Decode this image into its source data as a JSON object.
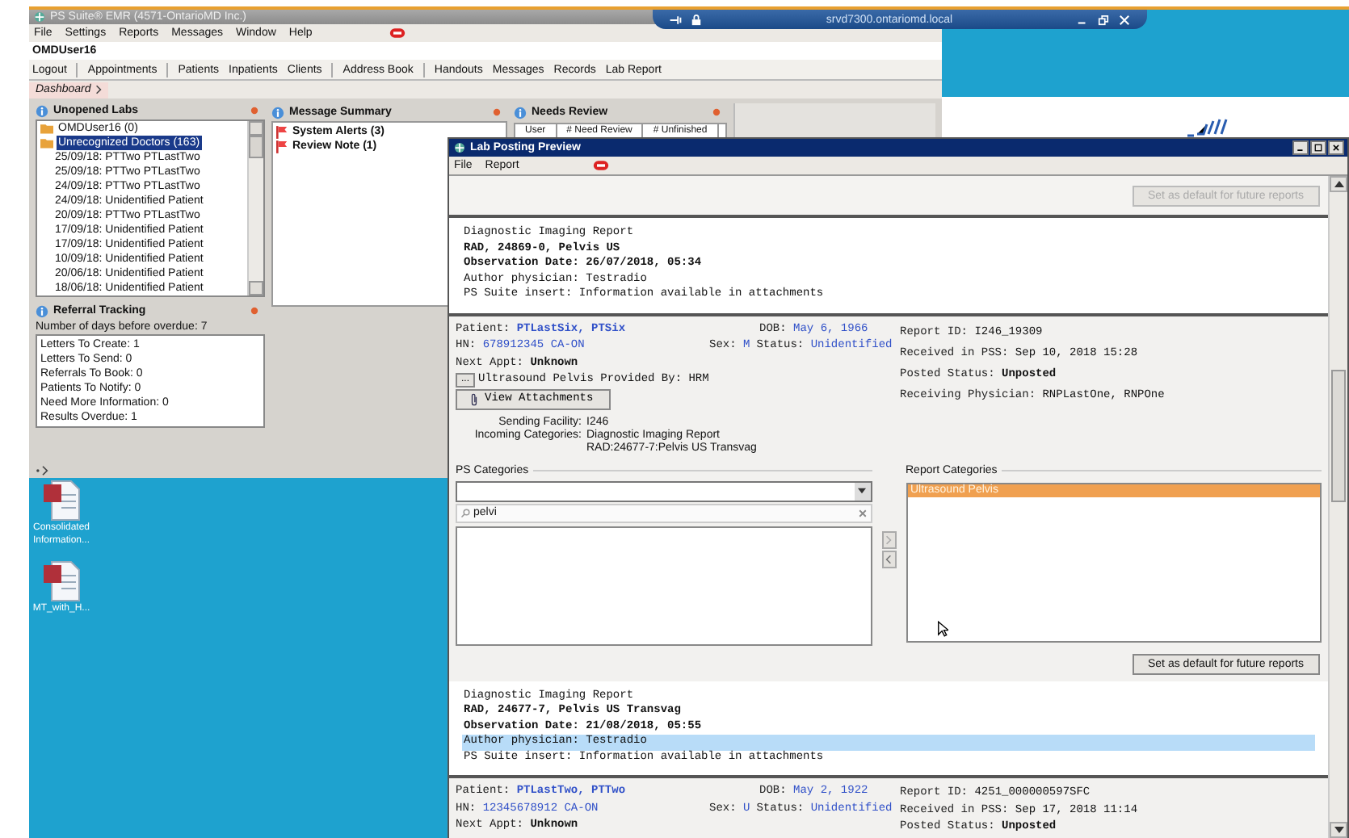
{
  "remote_bar": {
    "host": "srvd7300.ontariomd.local"
  },
  "emr": {
    "title": "PS Suite® EMR  (4571-OntarioMD Inc.)",
    "menu": [
      "File",
      "Settings",
      "Reports",
      "Messages",
      "Window",
      "Help"
    ],
    "user": "OMDUser16",
    "toolbar": [
      [
        "Logout"
      ],
      [
        "Appointments"
      ],
      [
        "Patients",
        "Inpatients",
        "Clients"
      ],
      [
        "Address Book"
      ],
      [
        "Handouts",
        "Messages",
        "Records",
        "Lab Report"
      ]
    ],
    "breadcrumb": "Dashboard",
    "unopened_labs": {
      "title": "Unopened Labs",
      "tree": [
        {
          "label": "OMDUser16 (0)",
          "selected": false
        },
        {
          "label": "Unrecognized Doctors (163)",
          "selected": true,
          "children": [
            {
              "label": "25/09/18: PTTwo PTLastTwo",
              "selected": false
            },
            {
              "label": "25/09/18: PTTwo PTLastTwo",
              "selected": false
            },
            {
              "label": "24/09/18: PTTwo PTLastTwo",
              "selected": false
            },
            {
              "label": "24/09/18: Unidentified Patient",
              "selected": false
            },
            {
              "label": "20/09/18: PTTwo PTLastTwo",
              "selected": false
            },
            {
              "label": "17/09/18: Unidentified Patient",
              "selected": false
            },
            {
              "label": "17/09/18: Unidentified Patient",
              "selected": false
            },
            {
              "label": "10/09/18: Unidentified Patient",
              "selected": false
            },
            {
              "label": "20/06/18: Unidentified Patient",
              "selected": false
            },
            {
              "label": "18/06/18: Unidentified Patient",
              "selected": false
            }
          ]
        }
      ]
    },
    "message_summary": {
      "title": "Message Summary",
      "items": [
        "System Alerts (3)",
        "Review Note (1)"
      ]
    },
    "needs_review": {
      "title": "Needs Review",
      "columns": [
        "User",
        "# Need Review",
        "# Unfinished"
      ]
    },
    "referral_tracking": {
      "title": "Referral Tracking",
      "overdue_note": "Number of days before overdue: 7",
      "items": [
        "Letters To Create: 1",
        "Letters To Send: 0",
        "Referrals To Book: 0",
        "Patients To Notify: 0",
        "Need More Information: 0",
        "Results Overdue: 1"
      ]
    }
  },
  "desktop_icons": [
    {
      "label": "Consolidated Information..."
    },
    {
      "label": "MT_with_H..."
    }
  ],
  "lab_preview": {
    "title": "Lab Posting Preview",
    "menu": [
      "File",
      "Report"
    ],
    "sections": [
      {
        "kind": "toolbar",
        "button": {
          "label": "Set as default for future reports",
          "disabled": true
        }
      },
      {
        "kind": "report",
        "lines": [
          {
            "text": "Diagnostic Imaging Report",
            "bold": false,
            "selected": false
          },
          {
            "text": "RAD, 24869-0, Pelvis US",
            "bold": true,
            "selected": false
          },
          {
            "text": "Observation Date: 26/07/2018, 05:34",
            "bold": true,
            "selected": false
          },
          {
            "text": "Author physician: Testradio",
            "bold": false,
            "selected": false
          },
          {
            "text": "PS Suite insert: Information available in attachments",
            "bold": false,
            "selected": false
          }
        ]
      },
      {
        "kind": "patient",
        "patient": {
          "label": "Patient:",
          "value": "PTLastSix, PTSix"
        },
        "dob": {
          "label": "DOB:",
          "value": "May 6, 1966"
        },
        "hn": {
          "label": "HN:",
          "value": "678912345 CA-ON"
        },
        "sex": {
          "label": "Sex:",
          "value": "M"
        },
        "status": {
          "label": "Status:",
          "value": "Unidentified"
        },
        "next_appt": {
          "label": "Next Appt:",
          "value": "Unknown"
        },
        "more_button": "...",
        "provided_by": "Ultrasound Pelvis Provided By: HRM",
        "attachments_button": "View Attachments",
        "report_info": [
          {
            "label": "Report ID:",
            "value": "I246_19309",
            "bold": false
          },
          {
            "label": "Received in PSS:",
            "value": "Sep 10, 2018 15:28",
            "bold": false
          },
          {
            "label": "Posted Status:",
            "value": "Unposted",
            "bold": true
          },
          {
            "label": "Receiving Physician:",
            "value": "RNPLastOne, RNPOne",
            "bold": false
          }
        ],
        "facility": [
          {
            "label": "Sending Facility:",
            "lines": [
              "I246"
            ]
          },
          {
            "label": "Incoming Categories:",
            "lines": [
              "Diagnostic Imaging Report",
              "RAD:24677-7:Pelvis US Transvag"
            ]
          }
        ],
        "categories": {
          "ps_title": "PS Categories",
          "search": {
            "value": "pelvi"
          },
          "report_title": "Report Categories",
          "report_items": [
            {
              "label": "Ultrasound Pelvis",
              "selected": true
            }
          ]
        },
        "default_button": {
          "label": "Set as default for future reports",
          "disabled": false
        }
      },
      {
        "kind": "report",
        "lines": [
          {
            "text": "Diagnostic Imaging Report",
            "bold": false,
            "selected": false
          },
          {
            "text": "RAD, 24677-7, Pelvis US Transvag",
            "bold": true,
            "selected": false
          },
          {
            "text": "Observation Date: 21/08/2018, 05:55",
            "bold": true,
            "selected": false
          },
          {
            "text": "Author physician: Testradio",
            "bold": false,
            "selected": true
          },
          {
            "text": "PS Suite insert: Information available in attachments",
            "bold": false,
            "selected": false
          }
        ]
      },
      {
        "kind": "patient",
        "patient": {
          "label": "Patient:",
          "value": "PTLastTwo, PTTwo"
        },
        "dob": {
          "label": "DOB:",
          "value": "May 2, 1922"
        },
        "hn": {
          "label": "HN:",
          "value": "12345678912 CA-ON"
        },
        "sex": {
          "label": "Sex:",
          "value": "U"
        },
        "status": {
          "label": "Status:",
          "value": "Unidentified"
        },
        "next_appt": {
          "label": "Next Appt:",
          "value": "Unknown"
        },
        "report_info": [
          {
            "label": "Report ID:",
            "value": "4251_000000597SFC",
            "bold": false
          },
          {
            "label": "Received in PSS:",
            "value": "Sep 17, 2018 11:14",
            "bold": false
          },
          {
            "label": "Posted Status:",
            "value": "Unposted",
            "bold": true
          }
        ]
      }
    ]
  }
}
